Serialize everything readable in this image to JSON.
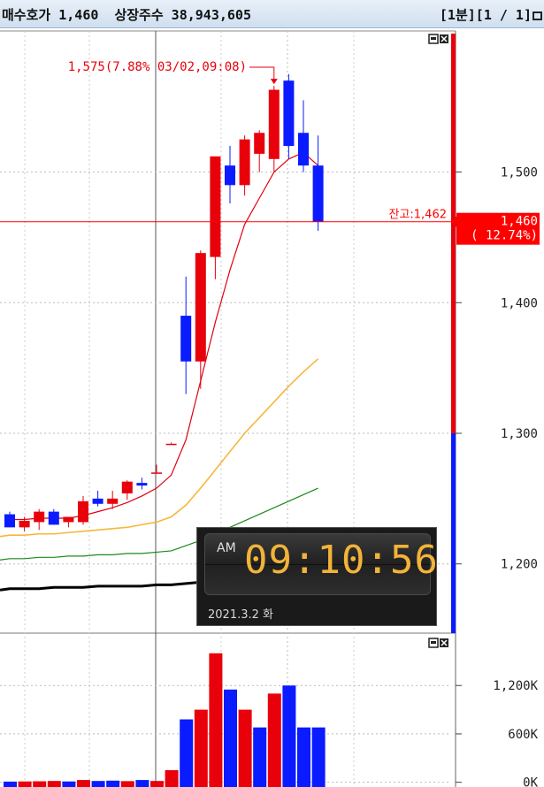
{
  "header": {
    "left_text": "매수호가 1,460  상장주수 38,943,605",
    "right_text": "[1분][1 / 1]"
  },
  "clock": {
    "ampm": "AM",
    "time": "09:10:56",
    "date": "2021.3.2 화"
  },
  "colors": {
    "up": "#e8000b",
    "down": "#0a1bff",
    "ma5": "#e00010",
    "ma20": "#f6b73c",
    "ma60": "#1a8a1a",
    "ma120": "#000000",
    "current_line": "#ff0000"
  },
  "chart_data": [
    {
      "type": "candlestick",
      "y_ticks": [
        1200,
        1300,
        1400,
        1500
      ],
      "y_tick_labels": [
        "1,200",
        "1,300",
        "1,400",
        "1,500"
      ],
      "ylim": [
        1147,
        1606
      ],
      "high_annotation": "1,575(7.88% 03/02,09:08)",
      "current_label": "잔고:1,462",
      "current_price_tag": [
        "1,460",
        "( 12.74%)"
      ],
      "current_value": 1462,
      "last_pct": "12.74",
      "candles": [
        {
          "o": 1238,
          "h": 1240,
          "l": 1228,
          "c": 1228
        },
        {
          "o": 1228,
          "h": 1236,
          "l": 1225,
          "c": 1233
        },
        {
          "o": 1232,
          "h": 1242,
          "l": 1226,
          "c": 1240
        },
        {
          "o": 1240,
          "h": 1242,
          "l": 1230,
          "c": 1230
        },
        {
          "o": 1232,
          "h": 1236,
          "l": 1228,
          "c": 1236
        },
        {
          "o": 1232,
          "h": 1252,
          "l": 1230,
          "c": 1248
        },
        {
          "o": 1250,
          "h": 1256,
          "l": 1244,
          "c": 1246
        },
        {
          "o": 1246,
          "h": 1256,
          "l": 1242,
          "c": 1250
        },
        {
          "o": 1254,
          "h": 1264,
          "l": 1249,
          "c": 1263
        },
        {
          "o": 1262,
          "h": 1266,
          "l": 1257,
          "c": 1260
        },
        {
          "o": 1270,
          "h": 1276,
          "l": 1270,
          "c": 1270
        },
        {
          "o": 1292,
          "h": 1293,
          "l": 1292,
          "c": 1292
        },
        {
          "o": 1390,
          "h": 1420,
          "l": 1330,
          "c": 1355
        },
        {
          "o": 1355,
          "h": 1440,
          "l": 1334,
          "c": 1438
        },
        {
          "o": 1435,
          "h": 1512,
          "l": 1418,
          "c": 1512
        },
        {
          "o": 1505,
          "h": 1520,
          "l": 1476,
          "c": 1490
        },
        {
          "o": 1490,
          "h": 1528,
          "l": 1482,
          "c": 1525
        },
        {
          "o": 1514,
          "h": 1532,
          "l": 1500,
          "c": 1530
        },
        {
          "o": 1510,
          "h": 1566,
          "l": 1500,
          "c": 1563
        },
        {
          "o": 1570,
          "h": 1575,
          "l": 1510,
          "c": 1520
        },
        {
          "o": 1530,
          "h": 1555,
          "l": 1500,
          "c": 1505
        },
        {
          "o": 1505,
          "h": 1528,
          "l": 1455,
          "c": 1462
        }
      ],
      "ma": [
        {
          "key": "ma5",
          "values": [
            1234,
            1234,
            1235,
            1235,
            1235,
            1237,
            1240,
            1243,
            1247,
            1252,
            1258,
            1268,
            1295,
            1340,
            1385,
            1425,
            1460,
            1480,
            1500,
            1510,
            1515,
            1505
          ]
        },
        {
          "key": "ma20",
          "values": [
            1222,
            1222,
            1223,
            1223,
            1224,
            1225,
            1226,
            1227,
            1228,
            1230,
            1232,
            1236,
            1245,
            1258,
            1272,
            1286,
            1300,
            1312,
            1324,
            1336,
            1347,
            1357
          ]
        },
        {
          "key": "ma60",
          "values": [
            1204,
            1204,
            1205,
            1205,
            1206,
            1206,
            1207,
            1207,
            1208,
            1208,
            1209,
            1210,
            1214,
            1218,
            1223,
            1228,
            1233,
            1238,
            1243,
            1248,
            1253,
            1258
          ]
        },
        {
          "key": "ma120",
          "values": [
            1181,
            1181,
            1181,
            1182,
            1182,
            1182,
            1183,
            1183,
            1183,
            1183,
            1184,
            1184,
            1185,
            1186,
            1187,
            1188,
            1189,
            1190,
            1191,
            1193,
            1194,
            1196
          ]
        }
      ]
    },
    {
      "type": "bar",
      "title": "volume",
      "y_ticks": [
        0,
        600000,
        1200000
      ],
      "y_tick_labels": [
        "0K",
        "600K",
        "1,200K"
      ],
      "ylim": [
        -15000,
        1740000
      ],
      "values": [
        8000,
        10000,
        12000,
        16000,
        10000,
        28000,
        16000,
        20000,
        14000,
        28000,
        16000,
        150000,
        780000,
        900000,
        1600000,
        1150000,
        900000,
        680000,
        1100000,
        1200000,
        680000,
        680000
      ],
      "colors": [
        "down",
        "up",
        "up",
        "up",
        "down",
        "up",
        "down",
        "down",
        "up",
        "down",
        "up",
        "up",
        "down",
        "up",
        "up",
        "down",
        "up",
        "down",
        "up",
        "down",
        "down",
        "down"
      ]
    }
  ]
}
